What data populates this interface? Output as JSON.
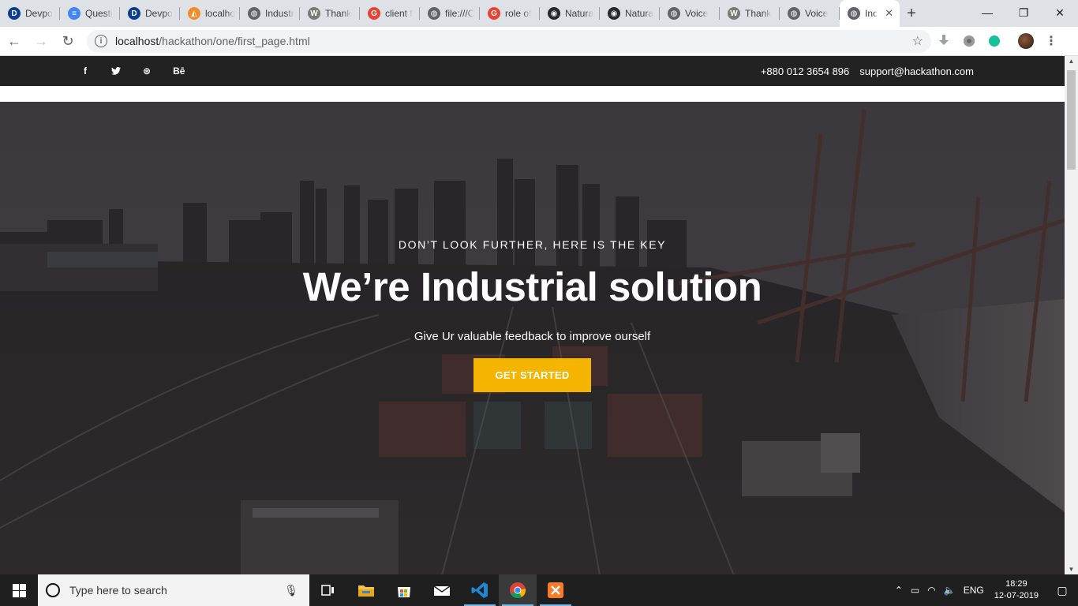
{
  "browser": {
    "tabs": [
      {
        "label": "Devpo",
        "icon": "devpost-icon",
        "color": "#0b3d91",
        "glyph": "D"
      },
      {
        "label": "Questi",
        "icon": "docs-icon",
        "color": "#4285f4",
        "glyph": "≡"
      },
      {
        "label": "Devpo",
        "icon": "devpost-icon",
        "color": "#0b3d91",
        "glyph": "D"
      },
      {
        "label": "localho",
        "icon": "xampp-icon",
        "color": "#f28c28",
        "glyph": "◭"
      },
      {
        "label": "Industr",
        "icon": "globe-icon",
        "color": "#5f6368",
        "glyph": "◍"
      },
      {
        "label": "Thank",
        "icon": "wordpress-icon",
        "color": "#7a7a7a",
        "glyph": "W"
      },
      {
        "label": "client f",
        "icon": "google-icon",
        "color": "#ea4335",
        "glyph": "G"
      },
      {
        "label": "file:///C",
        "icon": "globe-icon",
        "color": "#5f6368",
        "glyph": "◍"
      },
      {
        "label": "role of",
        "icon": "google-icon",
        "color": "#ea4335",
        "glyph": "G"
      },
      {
        "label": "Natura",
        "icon": "github-icon",
        "color": "#24292e",
        "glyph": "◉"
      },
      {
        "label": "Natura",
        "icon": "github-icon",
        "color": "#24292e",
        "glyph": "◉"
      },
      {
        "label": "Voice",
        "icon": "globe-icon",
        "color": "#5f6368",
        "glyph": "◍"
      },
      {
        "label": "Thank",
        "icon": "wordpress-icon",
        "color": "#7a7a7a",
        "glyph": "W"
      },
      {
        "label": "Voice",
        "icon": "globe-icon",
        "color": "#5f6368",
        "glyph": "◍"
      },
      {
        "label": "Inc",
        "icon": "globe-icon",
        "color": "#5f6368",
        "glyph": "◍",
        "active": true
      }
    ],
    "new_tab": "+",
    "window_controls": {
      "minimize": "—",
      "restore": "❐",
      "close": "✕"
    },
    "nav": {
      "back": "←",
      "forward": "→",
      "reload": "↻"
    },
    "url_host": "localhost",
    "url_path": "/hackathon/one/first_page.html",
    "bookmark": "☆"
  },
  "site": {
    "social": [
      "f",
      "t",
      "⊛",
      "Bē"
    ],
    "phone": "+880 012 3654 896",
    "email": "support@hackathon.com",
    "hero": {
      "kicker": "DON’T LOOK FURTHER, HERE IS THE KEY",
      "title": "We’re Industrial solution",
      "subtitle": "Give Ur valuable feedback to improve ourself",
      "cta": "GET STARTED"
    },
    "accent": "#f4b400"
  },
  "taskbar": {
    "search_placeholder": "Type here to search",
    "language": "ENG",
    "time": "18:29",
    "date": "12-07-2019"
  }
}
